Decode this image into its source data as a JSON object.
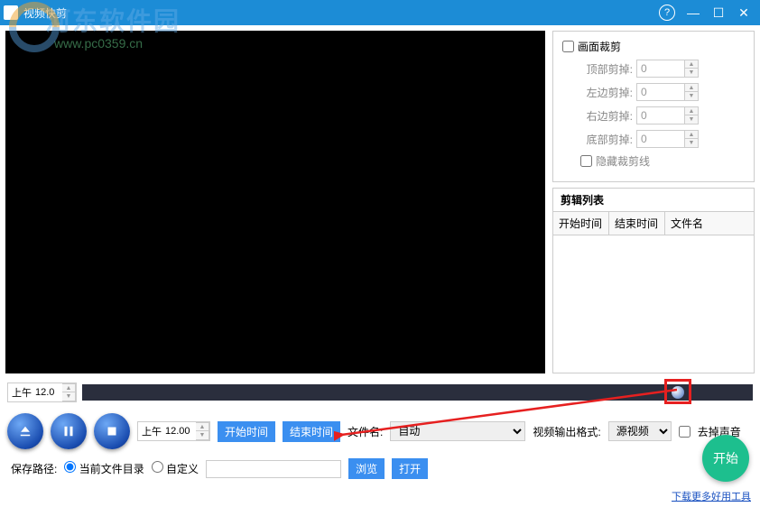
{
  "window": {
    "title": "视频快剪"
  },
  "watermark": {
    "text": "河东软件园",
    "url": "www.pc0359.cn"
  },
  "crop": {
    "enable_label": "画面裁剪",
    "top_label": "顶部剪掉:",
    "top_val": "0",
    "left_label": "左边剪掉:",
    "left_val": "0",
    "right_label": "右边剪掉:",
    "right_val": "0",
    "bottom_label": "底部剪掉:",
    "bottom_val": "0",
    "hide_lines_label": "隐藏裁剪线"
  },
  "cliplist": {
    "title": "剪辑列表",
    "col_start": "开始时间",
    "col_end": "结束时间",
    "col_file": "文件名"
  },
  "timeline": {
    "time_prefix": "上午",
    "time_val": "12.0"
  },
  "controls": {
    "time_prefix": "上午",
    "time_val": "12.00",
    "btn_start_time": "开始时间",
    "btn_end_time": "结束时间",
    "filename_label": "文件名:",
    "filename_value": "自动",
    "output_label": "视频输出格式:",
    "output_value": "源视频",
    "mute_label": "去掉声音"
  },
  "bottom": {
    "save_label": "保存路径:",
    "opt_current": "当前文件目录",
    "opt_custom": "自定义",
    "btn_browse": "浏览",
    "btn_open": "打开"
  },
  "start_button": "开始",
  "footer_link": "下载更多好用工具"
}
